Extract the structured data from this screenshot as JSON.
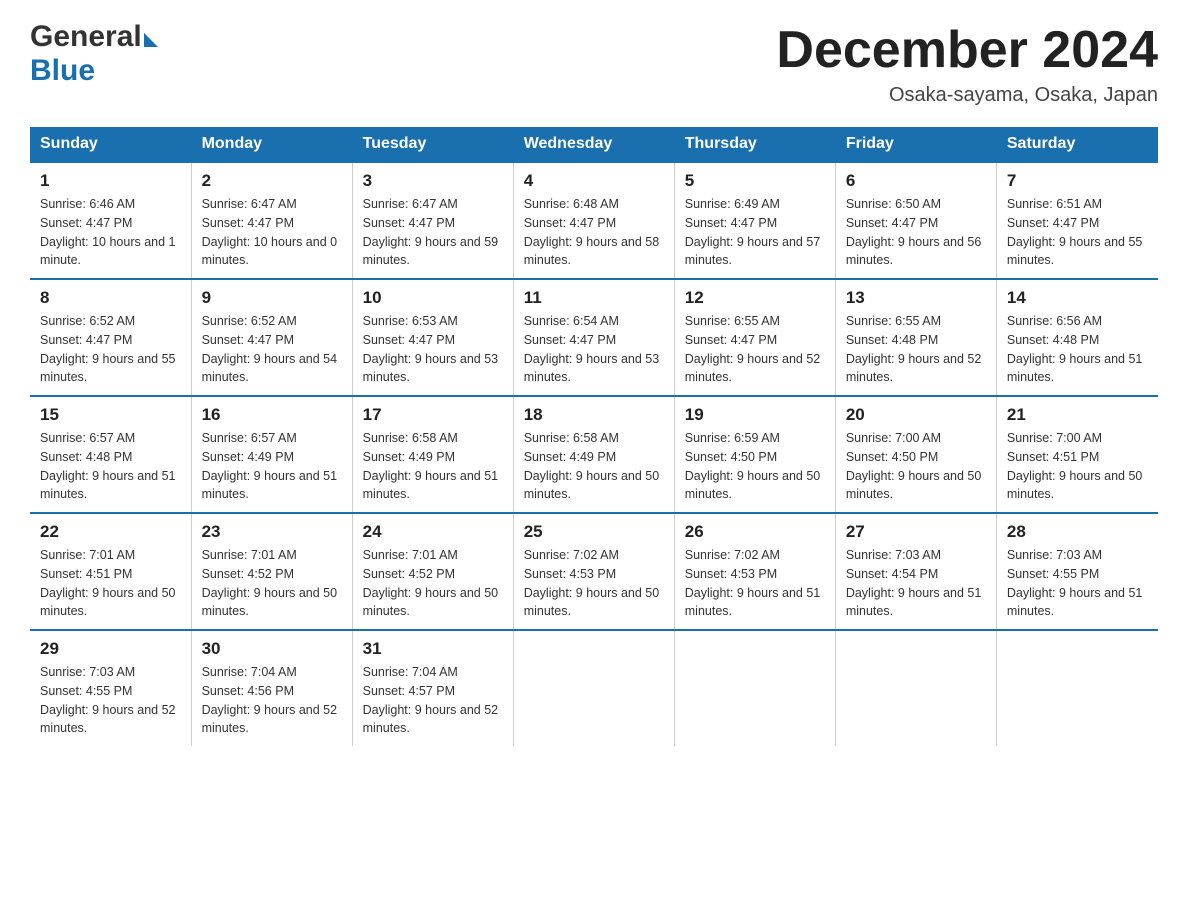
{
  "header": {
    "logo_general": "General",
    "logo_blue": "Blue",
    "month_title": "December 2024",
    "location": "Osaka-sayama, Osaka, Japan"
  },
  "weekdays": [
    "Sunday",
    "Monday",
    "Tuesday",
    "Wednesday",
    "Thursday",
    "Friday",
    "Saturday"
  ],
  "weeks": [
    [
      {
        "day": "1",
        "sunrise": "6:46 AM",
        "sunset": "4:47 PM",
        "daylight": "10 hours and 1 minute."
      },
      {
        "day": "2",
        "sunrise": "6:47 AM",
        "sunset": "4:47 PM",
        "daylight": "10 hours and 0 minutes."
      },
      {
        "day": "3",
        "sunrise": "6:47 AM",
        "sunset": "4:47 PM",
        "daylight": "9 hours and 59 minutes."
      },
      {
        "day": "4",
        "sunrise": "6:48 AM",
        "sunset": "4:47 PM",
        "daylight": "9 hours and 58 minutes."
      },
      {
        "day": "5",
        "sunrise": "6:49 AM",
        "sunset": "4:47 PM",
        "daylight": "9 hours and 57 minutes."
      },
      {
        "day": "6",
        "sunrise": "6:50 AM",
        "sunset": "4:47 PM",
        "daylight": "9 hours and 56 minutes."
      },
      {
        "day": "7",
        "sunrise": "6:51 AM",
        "sunset": "4:47 PM",
        "daylight": "9 hours and 55 minutes."
      }
    ],
    [
      {
        "day": "8",
        "sunrise": "6:52 AM",
        "sunset": "4:47 PM",
        "daylight": "9 hours and 55 minutes."
      },
      {
        "day": "9",
        "sunrise": "6:52 AM",
        "sunset": "4:47 PM",
        "daylight": "9 hours and 54 minutes."
      },
      {
        "day": "10",
        "sunrise": "6:53 AM",
        "sunset": "4:47 PM",
        "daylight": "9 hours and 53 minutes."
      },
      {
        "day": "11",
        "sunrise": "6:54 AM",
        "sunset": "4:47 PM",
        "daylight": "9 hours and 53 minutes."
      },
      {
        "day": "12",
        "sunrise": "6:55 AM",
        "sunset": "4:47 PM",
        "daylight": "9 hours and 52 minutes."
      },
      {
        "day": "13",
        "sunrise": "6:55 AM",
        "sunset": "4:48 PM",
        "daylight": "9 hours and 52 minutes."
      },
      {
        "day": "14",
        "sunrise": "6:56 AM",
        "sunset": "4:48 PM",
        "daylight": "9 hours and 51 minutes."
      }
    ],
    [
      {
        "day": "15",
        "sunrise": "6:57 AM",
        "sunset": "4:48 PM",
        "daylight": "9 hours and 51 minutes."
      },
      {
        "day": "16",
        "sunrise": "6:57 AM",
        "sunset": "4:49 PM",
        "daylight": "9 hours and 51 minutes."
      },
      {
        "day": "17",
        "sunrise": "6:58 AM",
        "sunset": "4:49 PM",
        "daylight": "9 hours and 51 minutes."
      },
      {
        "day": "18",
        "sunrise": "6:58 AM",
        "sunset": "4:49 PM",
        "daylight": "9 hours and 50 minutes."
      },
      {
        "day": "19",
        "sunrise": "6:59 AM",
        "sunset": "4:50 PM",
        "daylight": "9 hours and 50 minutes."
      },
      {
        "day": "20",
        "sunrise": "7:00 AM",
        "sunset": "4:50 PM",
        "daylight": "9 hours and 50 minutes."
      },
      {
        "day": "21",
        "sunrise": "7:00 AM",
        "sunset": "4:51 PM",
        "daylight": "9 hours and 50 minutes."
      }
    ],
    [
      {
        "day": "22",
        "sunrise": "7:01 AM",
        "sunset": "4:51 PM",
        "daylight": "9 hours and 50 minutes."
      },
      {
        "day": "23",
        "sunrise": "7:01 AM",
        "sunset": "4:52 PM",
        "daylight": "9 hours and 50 minutes."
      },
      {
        "day": "24",
        "sunrise": "7:01 AM",
        "sunset": "4:52 PM",
        "daylight": "9 hours and 50 minutes."
      },
      {
        "day": "25",
        "sunrise": "7:02 AM",
        "sunset": "4:53 PM",
        "daylight": "9 hours and 50 minutes."
      },
      {
        "day": "26",
        "sunrise": "7:02 AM",
        "sunset": "4:53 PM",
        "daylight": "9 hours and 51 minutes."
      },
      {
        "day": "27",
        "sunrise": "7:03 AM",
        "sunset": "4:54 PM",
        "daylight": "9 hours and 51 minutes."
      },
      {
        "day": "28",
        "sunrise": "7:03 AM",
        "sunset": "4:55 PM",
        "daylight": "9 hours and 51 minutes."
      }
    ],
    [
      {
        "day": "29",
        "sunrise": "7:03 AM",
        "sunset": "4:55 PM",
        "daylight": "9 hours and 52 minutes."
      },
      {
        "day": "30",
        "sunrise": "7:04 AM",
        "sunset": "4:56 PM",
        "daylight": "9 hours and 52 minutes."
      },
      {
        "day": "31",
        "sunrise": "7:04 AM",
        "sunset": "4:57 PM",
        "daylight": "9 hours and 52 minutes."
      },
      null,
      null,
      null,
      null
    ]
  ]
}
